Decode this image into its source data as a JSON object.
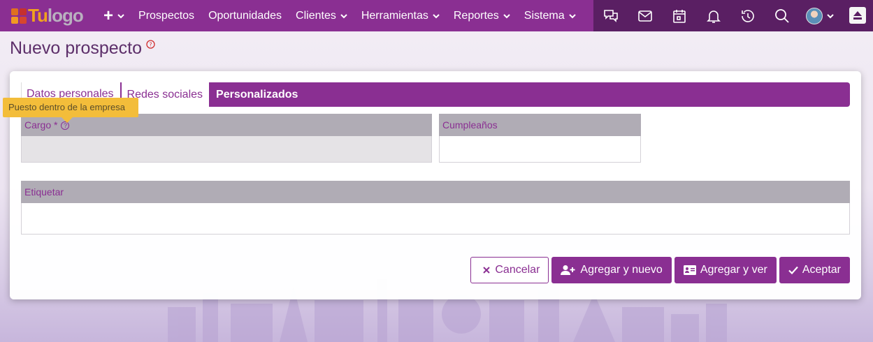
{
  "logo": {
    "text_a": "Tu",
    "text_b": "logo"
  },
  "navbar": {
    "items": [
      {
        "label": "Prospectos",
        "has_dropdown": false
      },
      {
        "label": "Oportunidades",
        "has_dropdown": false
      },
      {
        "label": "Clientes",
        "has_dropdown": true
      },
      {
        "label": "Herramientas",
        "has_dropdown": true
      },
      {
        "label": "Reportes",
        "has_dropdown": true
      },
      {
        "label": "Sistema",
        "has_dropdown": true
      }
    ],
    "right_icons": [
      "chat-icon",
      "mail-icon",
      "calendar-icon",
      "bell-icon",
      "history-icon",
      "search-icon"
    ],
    "colors": {
      "primary": "#8a2f92",
      "dark": "#5a1f63"
    }
  },
  "page": {
    "title": "Nuevo prospecto",
    "help_symbol": "?"
  },
  "tabs": [
    {
      "label": "Datos personales",
      "active": false
    },
    {
      "label": "Redes sociales",
      "active": false
    },
    {
      "label": "Personalizados",
      "active": true
    }
  ],
  "tooltip": {
    "text": "Puesto dentro de la empresa"
  },
  "fields": {
    "cargo": {
      "label": "Cargo *",
      "value": ""
    },
    "cumpleanos": {
      "label": "Cumpleaños",
      "value": ""
    },
    "etiquetar": {
      "label": "Etiquetar",
      "value": ""
    }
  },
  "buttons": {
    "cancel": "Cancelar",
    "add_new": "Agregar y nuevo",
    "add_view": "Agregar y ver",
    "accept": "Aceptar"
  }
}
